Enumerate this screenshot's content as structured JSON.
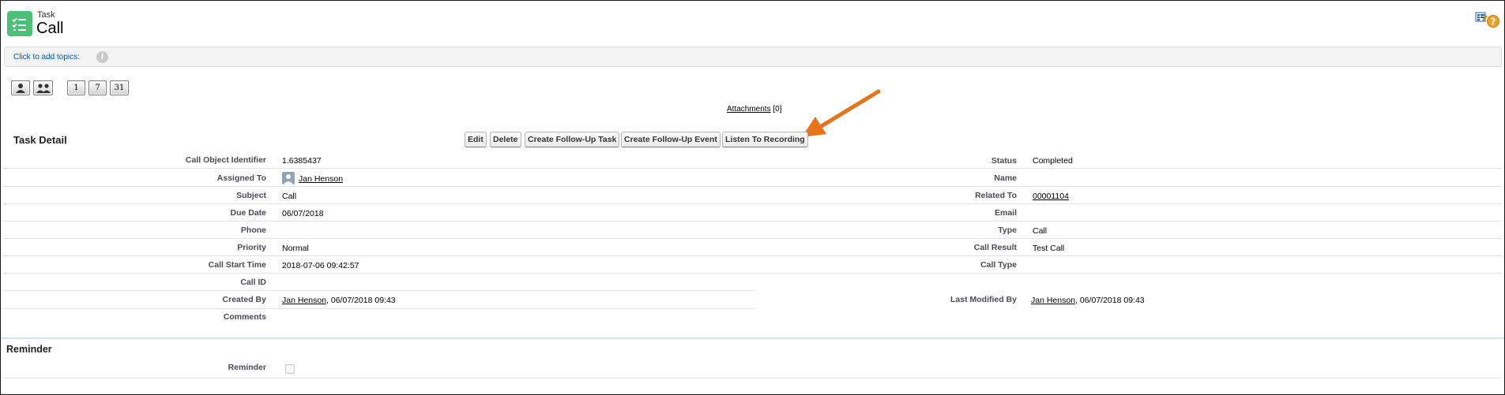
{
  "header": {
    "object_label": "Task",
    "record_title": "Call",
    "object_icon": "task-icon",
    "accent_color": "#4bc076",
    "help_icons": [
      "customize-page-icon",
      "help-icon"
    ]
  },
  "topics": {
    "link_label": "Click to add topics:",
    "info_icon": "info-icon"
  },
  "view_buttons": [
    {
      "name": "single-user-view-button",
      "label": ""
    },
    {
      "name": "multi-user-view-button",
      "label": ""
    },
    {
      "name": "day-view-button",
      "label": "1"
    },
    {
      "name": "week-view-button",
      "label": "7"
    },
    {
      "name": "month-view-button",
      "label": "31"
    }
  ],
  "attachments": {
    "label": "Attachments",
    "count": "[0]"
  },
  "task_detail": {
    "title": "Task Detail",
    "buttons": {
      "edit": "Edit",
      "delete": "Delete",
      "follow_up_task": "Create Follow-Up Task",
      "follow_up_event": "Create Follow-Up Event",
      "listen": "Listen To Recording"
    },
    "fields_left": [
      {
        "label": "Call Object Identifier",
        "value": "1.6385437"
      },
      {
        "label": "Assigned To",
        "value": "Jan Henson"
      },
      {
        "label": "Subject",
        "value": "Call"
      },
      {
        "label": "Due Date",
        "value": "06/07/2018"
      },
      {
        "label": "Phone",
        "value": ""
      },
      {
        "label": "Priority",
        "value": "Normal"
      },
      {
        "label": "Call Start Time",
        "value": "2018-07-06 09:42:57"
      },
      {
        "label": "Call ID",
        "value": ""
      },
      {
        "label": "Created By",
        "value": "Jan Henson",
        "suffix": ", 06/07/2018 09:43"
      },
      {
        "label": "Comments",
        "value": ""
      }
    ],
    "fields_right": [
      {
        "label": "Status",
        "value": "Completed"
      },
      {
        "label": "Name",
        "value": ""
      },
      {
        "label": "Related To",
        "value": "00001104"
      },
      {
        "label": "Email",
        "value": ""
      },
      {
        "label": "Type",
        "value": "Call"
      },
      {
        "label": "Call Result",
        "value": "Test Call"
      },
      {
        "label": "Call Type",
        "value": ""
      },
      {
        "label": "Last Modified By",
        "value": "Jan Henson",
        "suffix": ", 06/07/2018 09:43"
      }
    ]
  },
  "reminder": {
    "title": "Reminder",
    "label": "Reminder",
    "checked": false
  },
  "annotation": {
    "arrow_color": "#e8731a"
  }
}
